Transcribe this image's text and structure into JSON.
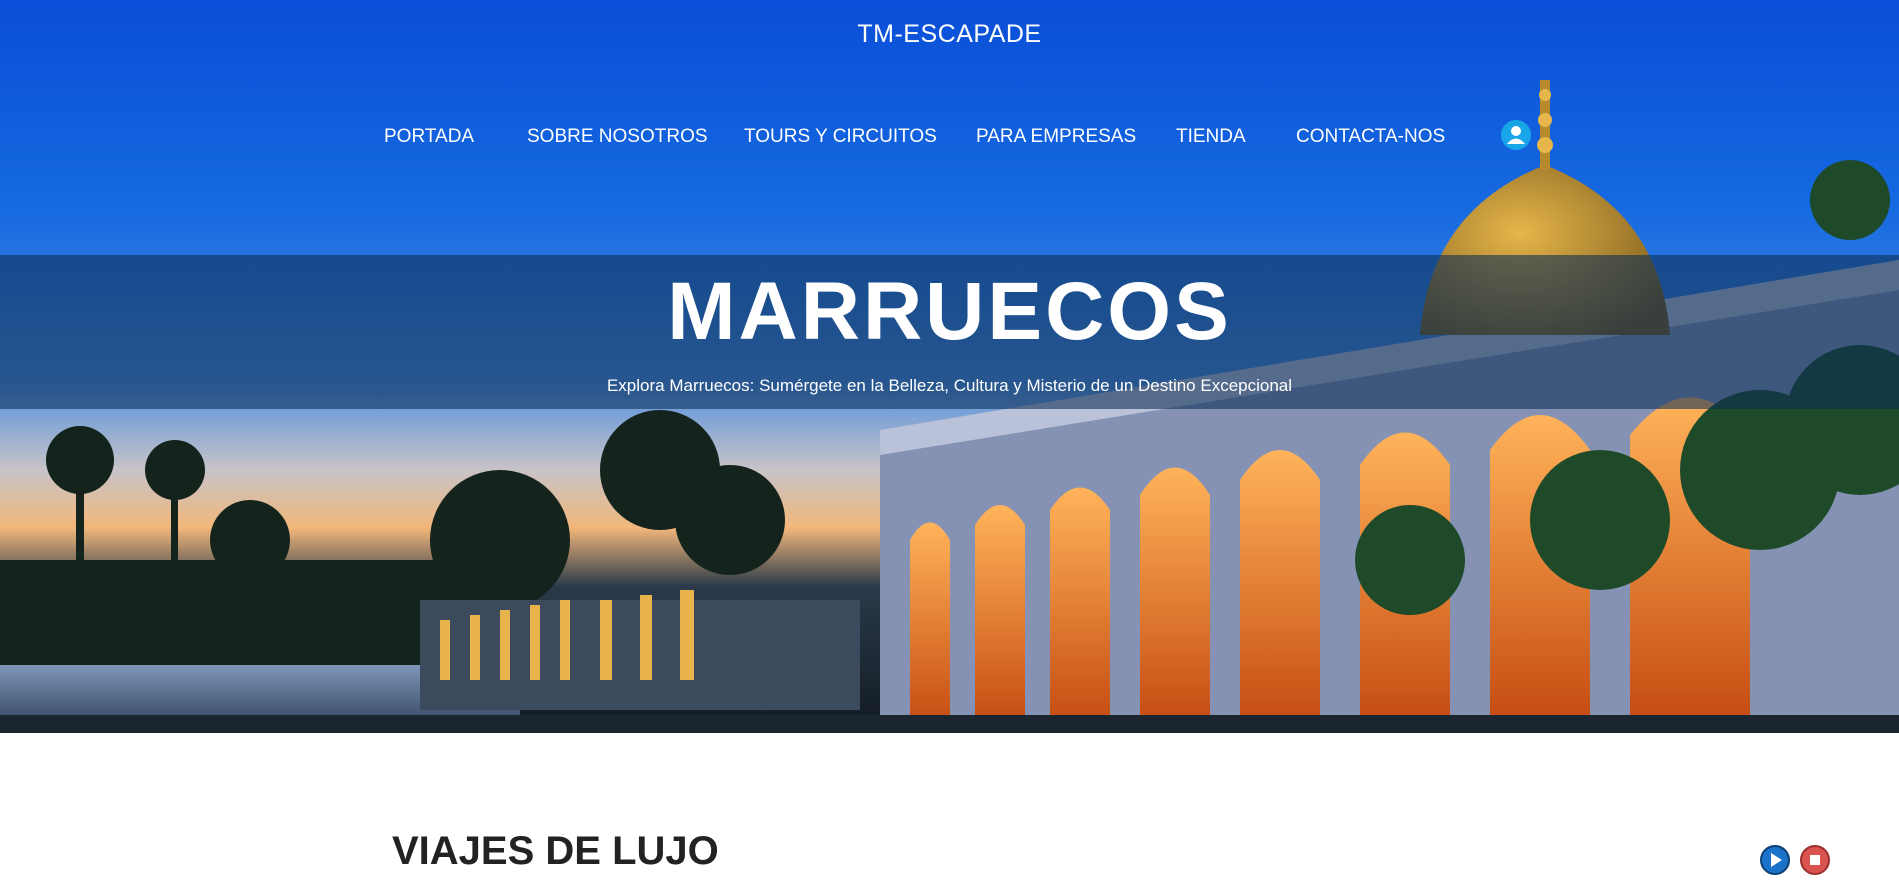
{
  "header": {
    "site_title": "TM-ESCAPADE"
  },
  "nav": {
    "items": [
      {
        "label": "PORTADA"
      },
      {
        "label": "SOBRE NOSOTROS"
      },
      {
        "label": "TOURS Y CIRCUITOS"
      },
      {
        "label": "PARA EMPRESAS"
      },
      {
        "label": "TIENDA"
      },
      {
        "label": "CONTACTA-NOS"
      }
    ],
    "account_icon": "user-icon"
  },
  "hero": {
    "title": "MARRUECOS",
    "subtitle": "Explora Marruecos: Sumérgete en la Belleza, Cultura y Misterio de un Destino Excepcional"
  },
  "content": {
    "section_title": "VIAJES DE LUJO"
  },
  "audio_controls": {
    "play_icon": "play-icon",
    "stop_icon": "stop-icon"
  },
  "colors": {
    "sky_top": "#0a4fd8",
    "accent_blue": "#19a6e8",
    "stop_red": "#d9534f"
  }
}
